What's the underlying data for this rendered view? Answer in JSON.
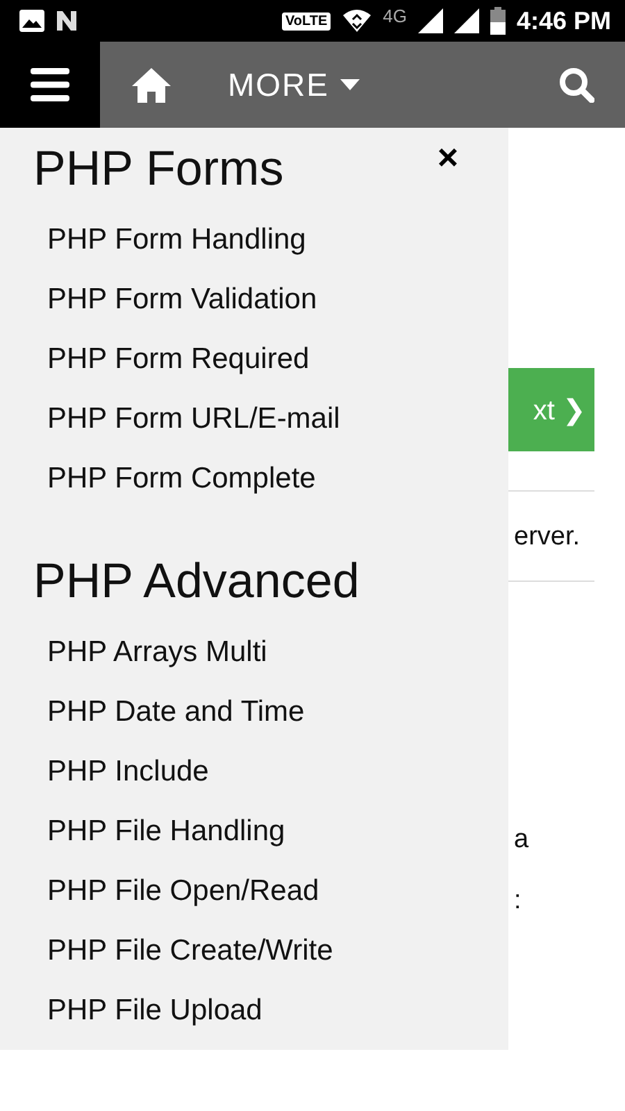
{
  "status_bar": {
    "network_badge": "VoLTE",
    "network_type": "4G",
    "time": "4:46 PM"
  },
  "nav": {
    "more_label": "MORE"
  },
  "page": {
    "next_button": "xt ❯",
    "texts": [
      {
        "kind": "line",
        "text": "erver."
      },
      {
        "kind": "gap",
        "text": "a"
      },
      {
        "kind": "line",
        "text": ":"
      }
    ]
  },
  "sidebar": {
    "close": "×",
    "sections": [
      {
        "title": "PHP Forms",
        "items": [
          "PHP Form Handling",
          "PHP Form Validation",
          "PHP Form Required",
          "PHP Form URL/E-mail",
          "PHP Form Complete"
        ]
      },
      {
        "title": "PHP Advanced",
        "items": [
          "PHP Arrays Multi",
          "PHP Date and Time",
          "PHP Include",
          "PHP File Handling",
          "PHP File Open/Read",
          "PHP File Create/Write",
          "PHP File Upload"
        ]
      }
    ]
  }
}
